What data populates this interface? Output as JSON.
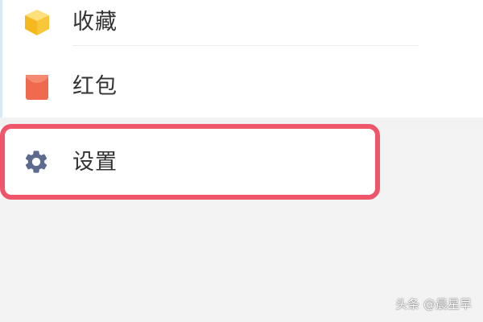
{
  "menu": {
    "items": [
      {
        "label": "收藏",
        "icon": "box-icon",
        "icon_color": "#f9c63a"
      },
      {
        "label": "红包",
        "icon": "red-envelope-icon",
        "icon_color": "#f06a4f"
      },
      {
        "label": "设置",
        "icon": "gear-icon",
        "icon_color": "#5b6a8d"
      }
    ]
  },
  "highlight_color": "#f0566a",
  "watermark": "头条 @晨星早"
}
